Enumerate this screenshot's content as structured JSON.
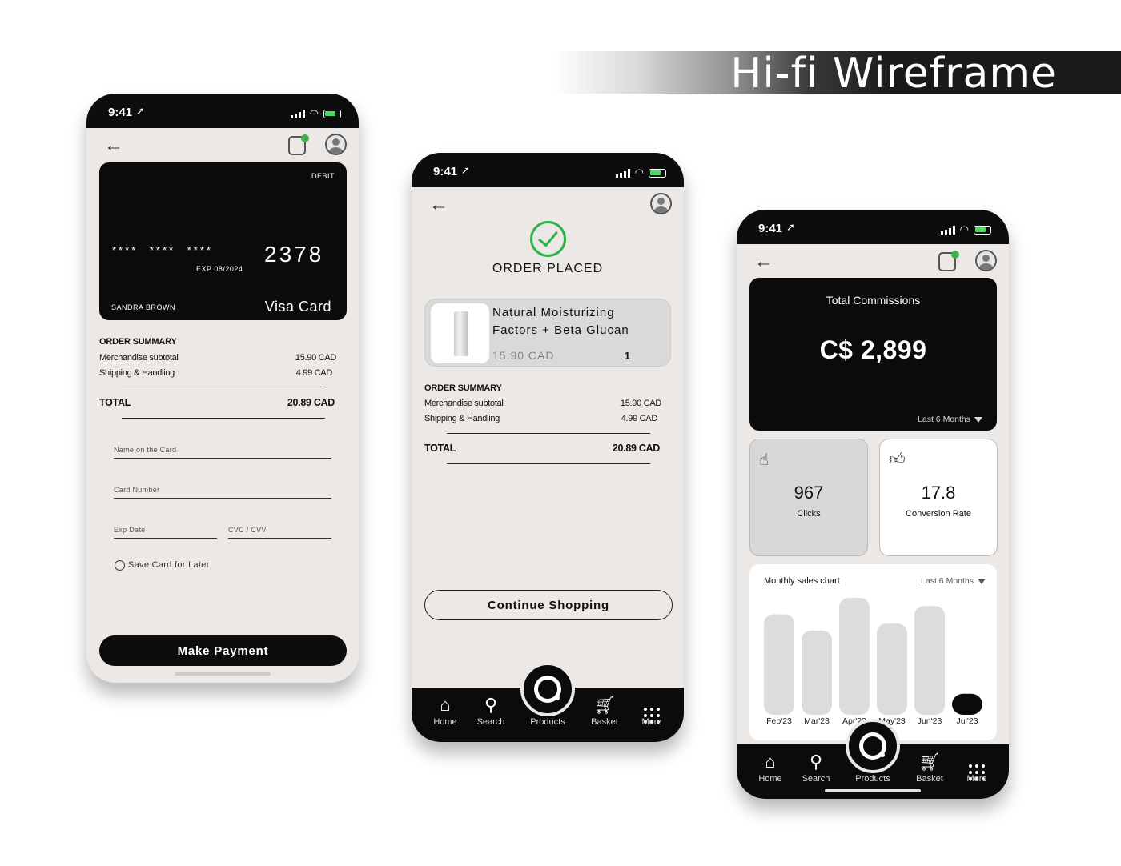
{
  "banner": {
    "title": "Hi-fi  Wireframe"
  },
  "status": {
    "time": "9:41"
  },
  "payment_screen": {
    "card": {
      "type": "DEBIT",
      "masked_number": "**** **** ****",
      "last4": "2378",
      "expiry": "EXP 08/2024",
      "holder": "SANDRA BROWN",
      "brand": "Visa Card"
    },
    "summary": {
      "title": "ORDER SUMMARY",
      "subtotal_label": "Merchandise subtotal",
      "subtotal_value": "15.90 CAD",
      "shipping_label": "Shipping & Handling",
      "shipping_value": "4.99 CAD",
      "total_label": "TOTAL",
      "total_value": "20.89 CAD"
    },
    "fields": {
      "name": "Name on the Card",
      "number": "Card Number",
      "exp": "Exp Date",
      "cvc": "CVC / CVV"
    },
    "save_card_label": "Save Card for Later",
    "pay_button": "Make Payment"
  },
  "confirmation_screen": {
    "heading": "ORDER PLACED",
    "product": {
      "name": "Natural Moisturizing Factors + Beta Glucan",
      "price": "15.90 CAD",
      "quantity": "1"
    },
    "summary": {
      "title": "ORDER SUMMARY",
      "subtotal_label": "Merchandise subtotal",
      "subtotal_value": "15.90 CAD",
      "shipping_label": "Shipping & Handling",
      "shipping_value": "4.99 CAD",
      "total_label": "TOTAL",
      "total_value": "20.89 CAD"
    },
    "continue_button": "Continue Shopping"
  },
  "tabbar": {
    "home": "Home",
    "search": "Search",
    "products": "Products",
    "basket": "Basket",
    "more": "More"
  },
  "dashboard_screen": {
    "commissions_title": "Total Commissions",
    "commissions_value": "C$ 2,899",
    "commissions_range": "Last 6 Months",
    "clicks_value": "967",
    "clicks_label": "Clicks",
    "conversion_value": "17.8",
    "conversion_label": "Conversion Rate",
    "chart_title": "Monthly sales chart",
    "chart_range": "Last 6 Months"
  },
  "colors": {
    "accent_green": "#2db24a",
    "screen_bg": "#ebe8e5",
    "dark": "#0b0b0b",
    "bar_grey": "#dcdcdc"
  },
  "chart_data": {
    "type": "bar",
    "title": "Monthly sales chart",
    "categories": [
      "Feb'23",
      "Mar'23",
      "Apr'23",
      "May'23",
      "Jun'23",
      "Jul'23"
    ],
    "values": [
      86,
      72,
      100,
      78,
      93,
      18
    ],
    "highlight_index": 5,
    "ylim": [
      0,
      100
    ],
    "grid": false,
    "legend": "none"
  }
}
